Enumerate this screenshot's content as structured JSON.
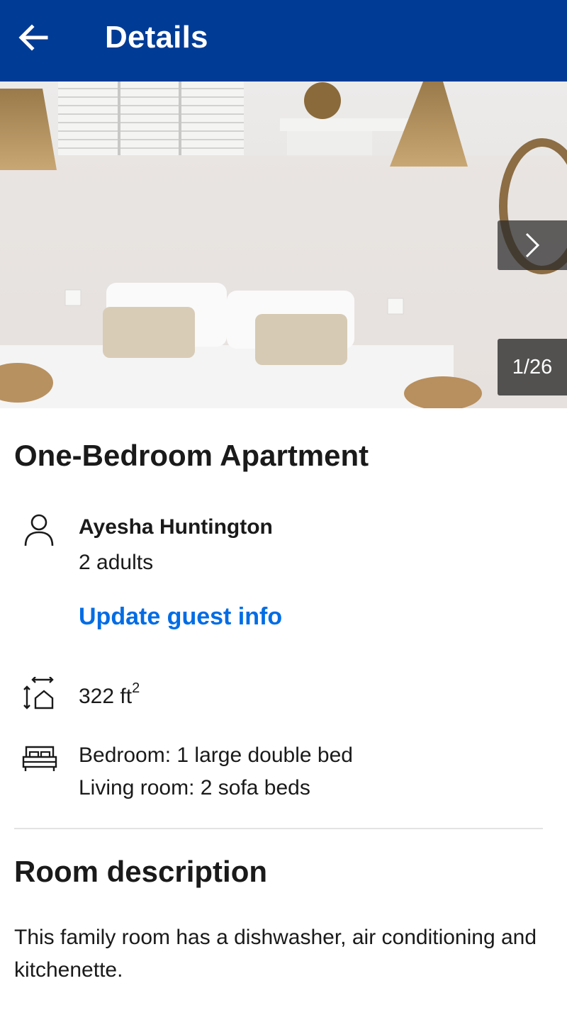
{
  "header": {
    "title": "Details",
    "back_icon": "arrow-left-icon",
    "background": "#003b95"
  },
  "gallery": {
    "counter": "1/26",
    "next_icon": "chevron-right-icon"
  },
  "room": {
    "title": "One-Bedroom Apartment"
  },
  "guest": {
    "icon": "person-icon",
    "name": "Ayesha Huntington",
    "count": "2 adults",
    "update_link": "Update guest info",
    "link_color": "#006ce4"
  },
  "size": {
    "icon": "room-size-icon",
    "value": "322 ft",
    "unit_superscript": "2"
  },
  "beds": {
    "icon": "bed-icon",
    "line1": "Bedroom: 1 large double bed",
    "line2": "Living room: 2 sofa beds"
  },
  "description": {
    "heading": "Room description",
    "body": "This family room has a dishwasher, air conditioning and kitchenette."
  }
}
